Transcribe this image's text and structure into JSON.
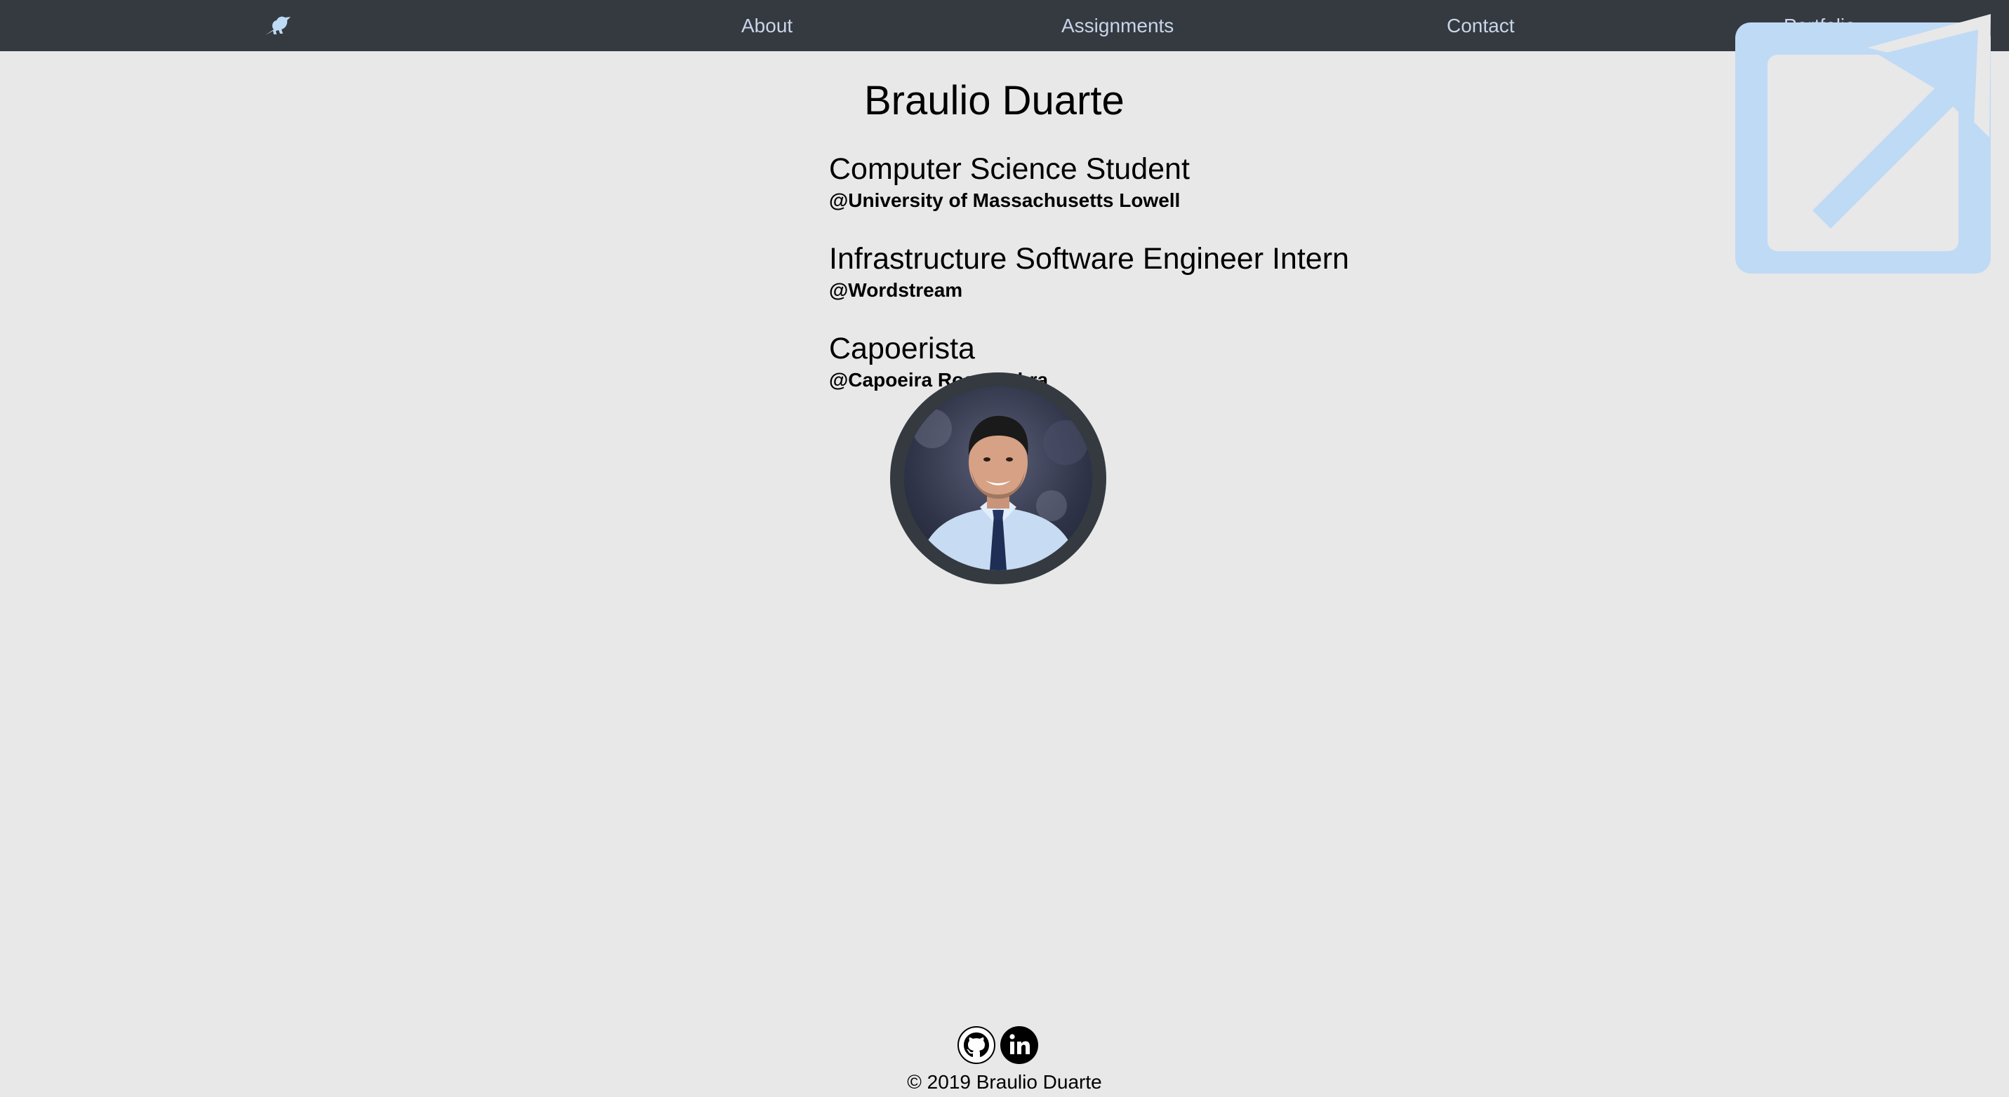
{
  "navbar": {
    "logo_icon": "bird-icon",
    "links": [
      {
        "label": "About"
      },
      {
        "label": "Assignments"
      },
      {
        "label": "Contact"
      },
      {
        "label": "Portfolio"
      }
    ]
  },
  "main": {
    "name": "Braulio Duarte",
    "roles": [
      {
        "title": "Computer Science Student",
        "org": "@University of Massachusetts Lowell"
      },
      {
        "title": "Infrastructure Software Engineer Intern",
        "org": "@Wordstream"
      },
      {
        "title": "Capoerista",
        "org": "@Capoeira Rosa Rubra"
      }
    ],
    "avatar_icon": "profile-photo"
  },
  "overlay": {
    "icon": "external-link-icon"
  },
  "footer": {
    "social": [
      {
        "icon": "github-icon"
      },
      {
        "icon": "linkedin-icon"
      }
    ],
    "copyright": "© 2019 Braulio Duarte"
  },
  "colors": {
    "navbar_bg": "#343a40",
    "nav_link": "#c9d4e8",
    "page_bg": "#e8e8e8",
    "accent_light_blue": "#bfdaf5"
  }
}
